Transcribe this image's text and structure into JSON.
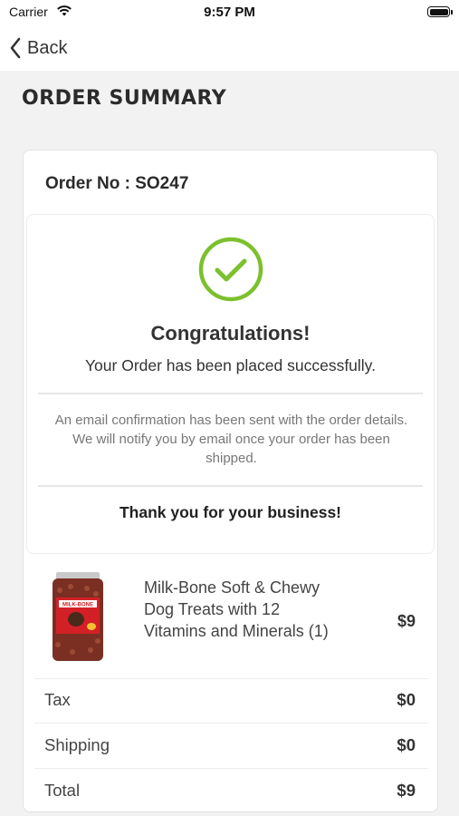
{
  "status_bar": {
    "carrier": "Carrier",
    "time": "9:57 PM"
  },
  "nav": {
    "back_label": "Back"
  },
  "page": {
    "title": "ORDER SUMMARY"
  },
  "order": {
    "number_label": "Order No : SO247",
    "congrats": "Congratulations!",
    "placed": "Your Order has been placed successfully.",
    "email_note": "An email confirmation has been sent with the order details. We will notify you by email once your order has been shipped.",
    "thanks": "Thank you for your business!"
  },
  "item": {
    "name": "Milk-Bone Soft & Chewy Dog Treats with 12 Vitamins and Minerals (1)",
    "price": "$9",
    "image_label": "MILK-BONE"
  },
  "totals": [
    {
      "label": "Tax",
      "value": "$0"
    },
    {
      "label": "Shipping",
      "value": "$0"
    },
    {
      "label": "Total",
      "value": "$9"
    }
  ],
  "colors": {
    "success": "#7cc02e",
    "background": "#f2f2f2"
  }
}
